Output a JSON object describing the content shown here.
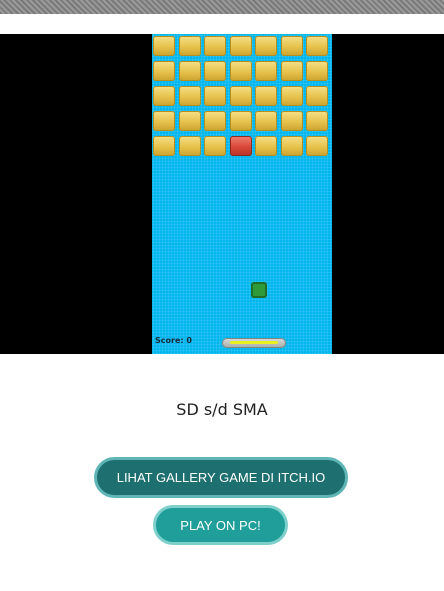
{
  "game": {
    "score_text": "Score: 0",
    "bricks": {
      "rows": 5,
      "cols": 7,
      "red_cell": {
        "row": 4,
        "col": 3
      }
    },
    "colors": {
      "background": "#00b6ee",
      "brick": "#e6c24c",
      "brick_hit": "#d9483a",
      "ball": "#2f9a3a",
      "paddle_stripe": "#e8f020"
    }
  },
  "category_label": "SD s/d SMA",
  "buttons": {
    "gallery_label": "LIHAT GALLERY GAME DI ITCH.IO",
    "play_label": "PLAY ON PC!"
  }
}
